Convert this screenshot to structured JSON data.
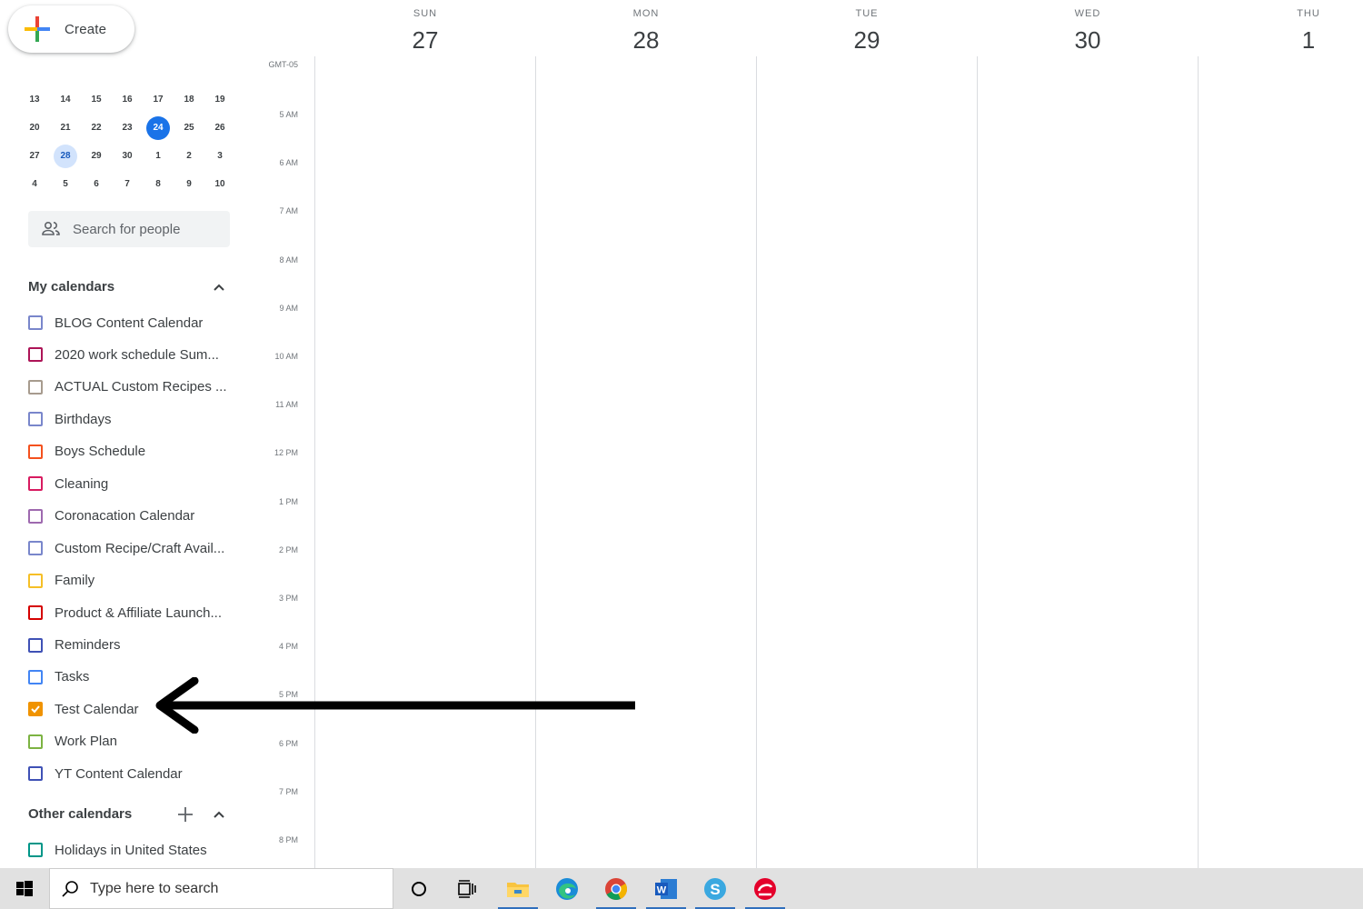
{
  "create": {
    "label": "Create"
  },
  "mini_calendar": {
    "weeks": [
      [
        "13",
        "14",
        "15",
        "16",
        "17",
        "18",
        "19"
      ],
      [
        "20",
        "21",
        "22",
        "23",
        "24",
        "25",
        "26"
      ],
      [
        "27",
        "28",
        "29",
        "30",
        "1",
        "2",
        "3"
      ],
      [
        "4",
        "5",
        "6",
        "7",
        "8",
        "9",
        "10"
      ]
    ],
    "today": "24",
    "selected": "28"
  },
  "people_search": {
    "placeholder": "Search for people"
  },
  "my_calendars": {
    "title": "My calendars",
    "items": [
      {
        "label": "BLOG Content Calendar",
        "color": "#7986cb",
        "checked": false
      },
      {
        "label": "2020 work schedule Sum...",
        "color": "#ad1457",
        "checked": false
      },
      {
        "label": "ACTUAL Custom Recipes ...",
        "color": "#a79b8e",
        "checked": false
      },
      {
        "label": "Birthdays",
        "color": "#7986cb",
        "checked": false
      },
      {
        "label": "Boys Schedule",
        "color": "#f4511e",
        "checked": false
      },
      {
        "label": "Cleaning",
        "color": "#d81b60",
        "checked": false
      },
      {
        "label": "Coronacation Calendar",
        "color": "#9e69af",
        "checked": false
      },
      {
        "label": "Custom Recipe/Craft Avail...",
        "color": "#7986cb",
        "checked": false
      },
      {
        "label": "Family",
        "color": "#f6bf26",
        "checked": false
      },
      {
        "label": "Product & Affiliate Launch...",
        "color": "#d50000",
        "checked": false
      },
      {
        "label": "Reminders",
        "color": "#3f51b5",
        "checked": false
      },
      {
        "label": "Tasks",
        "color": "#4285f4",
        "checked": false
      },
      {
        "label": "Test Calendar",
        "color": "#f09300",
        "checked": true
      },
      {
        "label": "Work Plan",
        "color": "#7cb342",
        "checked": false
      },
      {
        "label": "YT Content Calendar",
        "color": "#3f51b5",
        "checked": false
      }
    ]
  },
  "other_calendars": {
    "title": "Other calendars",
    "items": [
      {
        "label": "Holidays in United States",
        "color": "#009688",
        "checked": false
      }
    ]
  },
  "timezone": "GMT-05",
  "days": [
    {
      "dow": "SUN",
      "num": "27"
    },
    {
      "dow": "MON",
      "num": "28"
    },
    {
      "dow": "TUE",
      "num": "29"
    },
    {
      "dow": "WED",
      "num": "30"
    },
    {
      "dow": "THU",
      "num": "1"
    }
  ],
  "hours": [
    "5 AM",
    "6 AM",
    "7 AM",
    "8 AM",
    "9 AM",
    "10 AM",
    "11 AM",
    "12 PM",
    "1 PM",
    "2 PM",
    "3 PM",
    "4 PM",
    "5 PM",
    "6 PM",
    "7 PM",
    "8 PM"
  ],
  "taskbar": {
    "search_placeholder": "Type here to search",
    "apps": [
      "windows-start-icon",
      "cortana-icon",
      "task-view-icon",
      "file-explorer-icon",
      "edge-icon",
      "chrome-icon",
      "word-icon",
      "snagit-icon",
      "trend-micro-icon"
    ]
  }
}
